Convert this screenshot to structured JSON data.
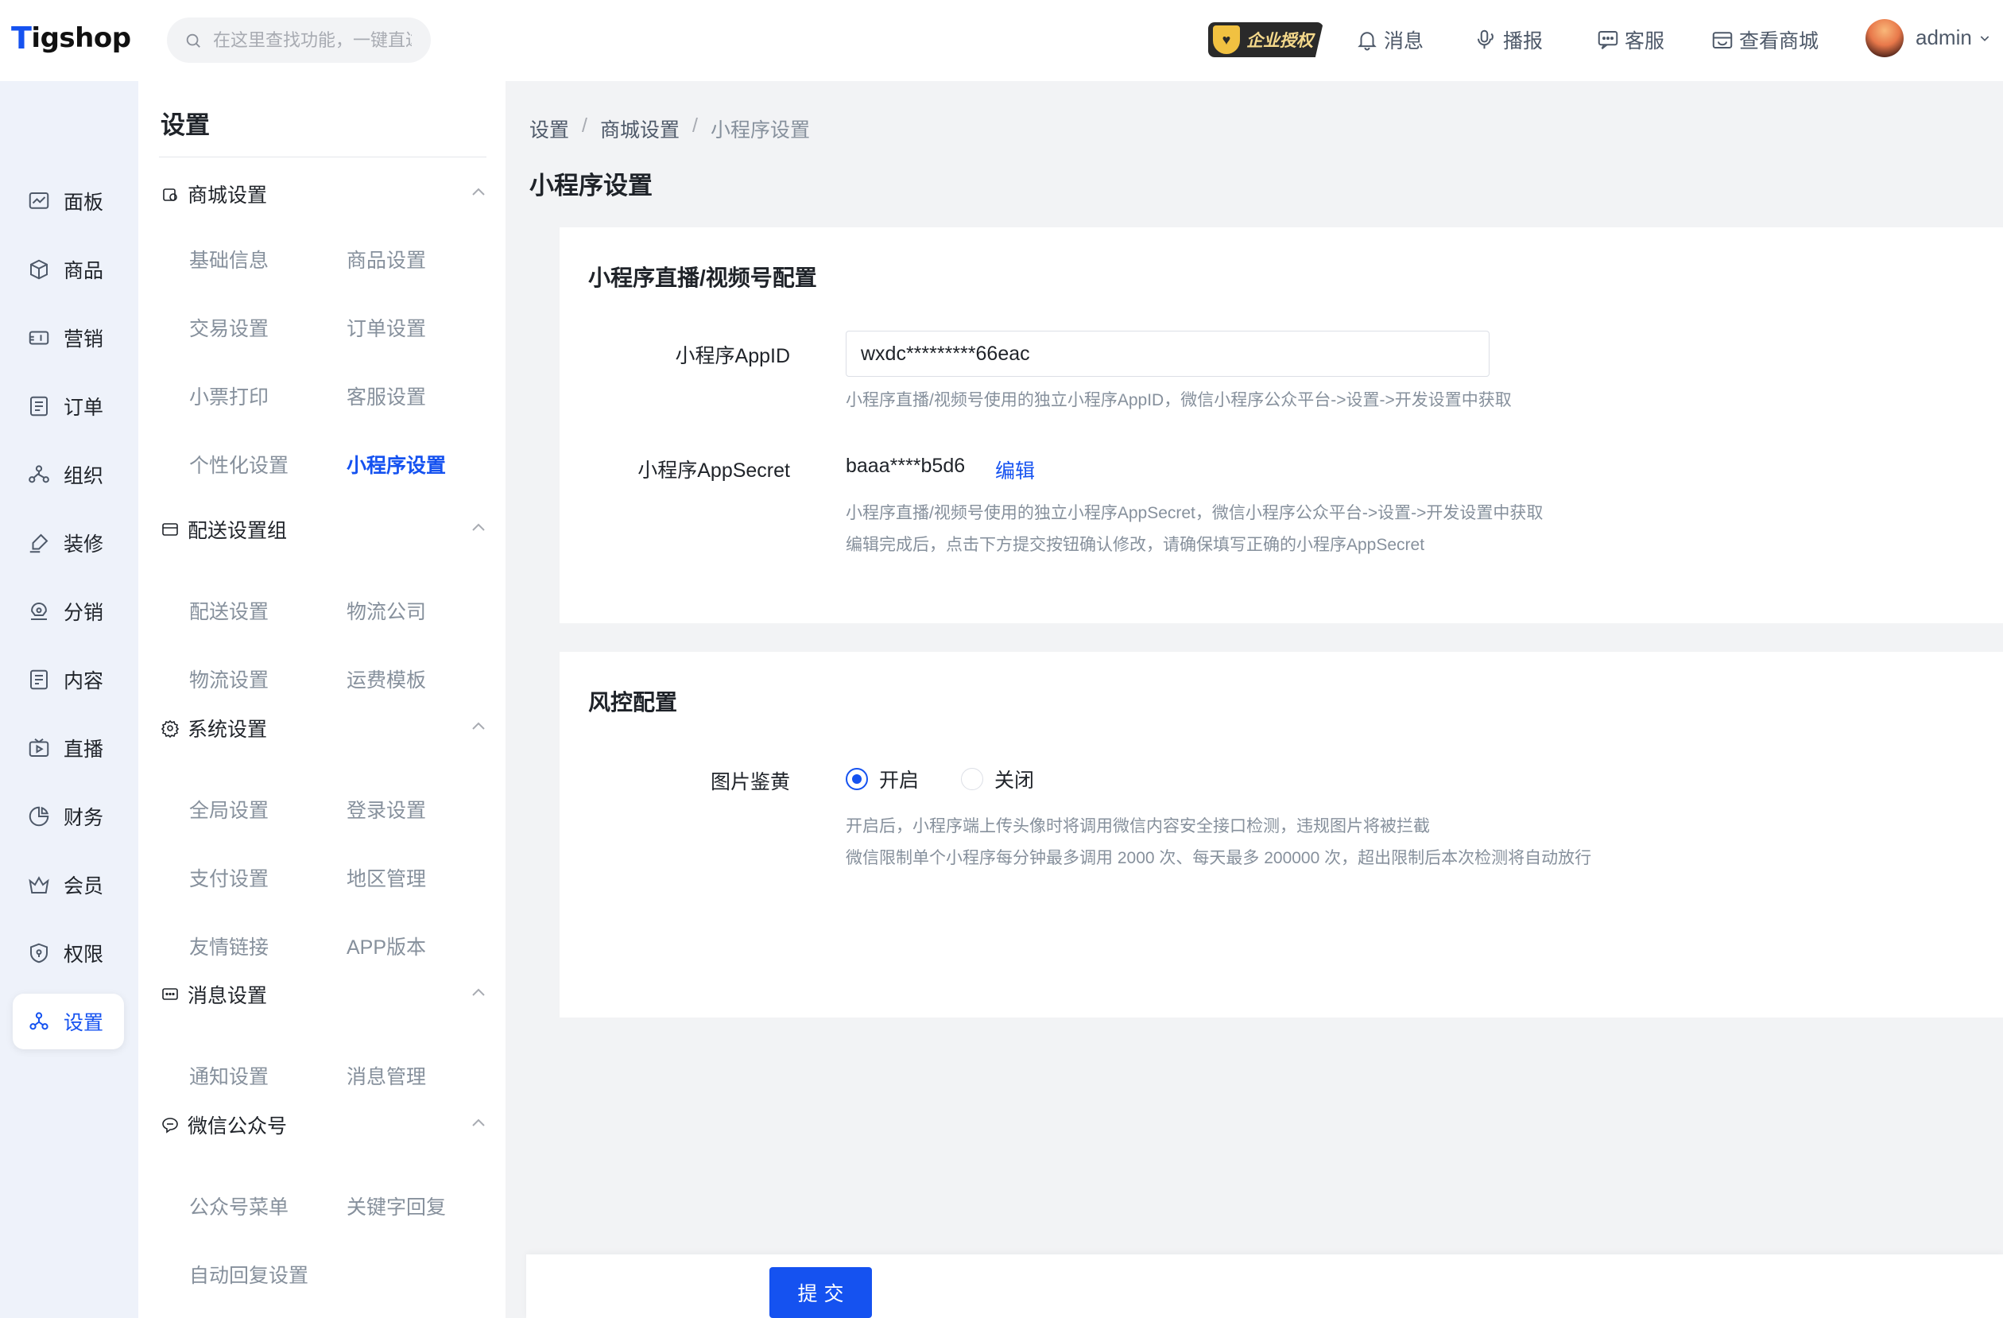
{
  "header": {
    "logo": "Tigshop",
    "search_placeholder": "在这里查找功能，一键直达",
    "badge": "企业授权",
    "items": [
      {
        "label": "消息",
        "icon": "bell-icon"
      },
      {
        "label": "播报",
        "icon": "broadcast-icon"
      },
      {
        "label": "客服",
        "icon": "chat-icon"
      },
      {
        "label": "查看商城",
        "icon": "store-icon"
      }
    ],
    "user": "admin"
  },
  "nav": {
    "items": [
      {
        "label": "面板",
        "icon": "dashboard-icon"
      },
      {
        "label": "商品",
        "icon": "box-icon"
      },
      {
        "label": "营销",
        "icon": "ticket-icon"
      },
      {
        "label": "订单",
        "icon": "order-icon"
      },
      {
        "label": "组织",
        "icon": "org-icon"
      },
      {
        "label": "装修",
        "icon": "brush-icon"
      },
      {
        "label": "分销",
        "icon": "distribution-icon"
      },
      {
        "label": "内容",
        "icon": "content-icon"
      },
      {
        "label": "直播",
        "icon": "live-icon"
      },
      {
        "label": "财务",
        "icon": "pie-icon"
      },
      {
        "label": "会员",
        "icon": "crown-icon"
      },
      {
        "label": "权限",
        "icon": "shield-icon"
      },
      {
        "label": "设置",
        "icon": "settings-icon",
        "active": true
      }
    ]
  },
  "sub": {
    "title": "设置",
    "groups": [
      {
        "label": "商城设置",
        "links": [
          "基础信息",
          "商品设置",
          "交易设置",
          "订单设置",
          "小票打印",
          "客服设置",
          "个性化设置",
          "小程序设置"
        ]
      },
      {
        "label": "配送设置组",
        "links": [
          "配送设置",
          "物流公司",
          "物流设置",
          "运费模板"
        ]
      },
      {
        "label": "系统设置",
        "links": [
          "全局设置",
          "登录设置",
          "支付设置",
          "地区管理",
          "友情链接",
          "APP版本"
        ]
      },
      {
        "label": "消息设置",
        "links": [
          "通知设置",
          "消息管理"
        ]
      },
      {
        "label": "微信公众号",
        "links": [
          "公众号菜单",
          "关键字回复",
          "自动回复设置"
        ]
      }
    ],
    "active_link": "小程序设置"
  },
  "main": {
    "breadcrumb": [
      "设置",
      "商城设置",
      "小程序设置"
    ],
    "title": "小程序设置",
    "card1": {
      "title": "小程序直播/视频号配置",
      "appid_label": "小程序AppID",
      "appid_value": "wxdc*********66eac",
      "appid_hint": "小程序直播/视频号使用的独立小程序AppID，微信小程序公众平台->设置->开发设置中获取",
      "secret_label": "小程序AppSecret",
      "secret_value": "baaa****b5d6",
      "secret_edit": "编辑",
      "secret_hint1": "小程序直播/视频号使用的独立小程序AppSecret，微信小程序公众平台->设置->开发设置中获取",
      "secret_hint2": "编辑完成后，点击下方提交按钮确认修改，请确保填写正确的小程序AppSecret"
    },
    "card2": {
      "title": "风控配置",
      "img_label": "图片鉴黄",
      "opt_on": "开启",
      "opt_off": "关闭",
      "selected": "开启",
      "hint1": "开启后，小程序端上传头像时将调用微信内容安全接口检测，违规图片将被拦截",
      "hint2": "微信限制单个小程序每分钟最多调用 2000 次、每天最多 200000 次，超出限制后本次检测将自动放行"
    },
    "submit": "提交"
  },
  "colors": {
    "accent": "#1552f0",
    "bg": "#f2f3f5"
  }
}
